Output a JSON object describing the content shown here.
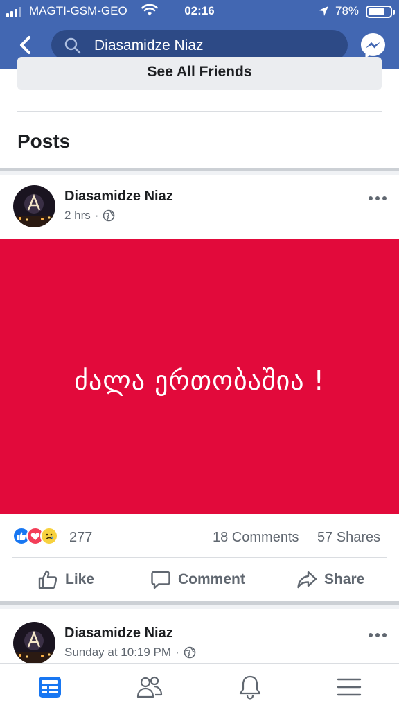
{
  "status_bar": {
    "carrier": "MAGTI-GSM-GEO",
    "time": "02:16",
    "battery": "78%",
    "battery_level": 0.78
  },
  "header": {
    "search_query": "Diasamidze Niaz"
  },
  "friends": {
    "see_all_label": "See All Friends"
  },
  "posts_heading": "Posts",
  "posts": [
    {
      "author": "Diasamidze Niaz",
      "time": "2 hrs",
      "privacy_icon": "globe-icon",
      "image_text": "ძალა ერთობაშია !",
      "image_bg": "#e20a3b",
      "reactions": [
        "like",
        "love",
        "sad"
      ],
      "reaction_count": "277",
      "comments": "18 Comments",
      "shares": "57 Shares"
    },
    {
      "author": "Diasamidze Niaz",
      "time": "Sunday at 10:19 PM",
      "privacy_icon": "globe-icon"
    }
  ],
  "actions": {
    "like": "Like",
    "comment": "Comment",
    "share": "Share"
  },
  "tabs": [
    "news-feed",
    "friends",
    "notifications",
    "menu"
  ],
  "colors": {
    "brand": "#4267b2",
    "active_tab": "#1877f2",
    "inactive": "#606770"
  }
}
